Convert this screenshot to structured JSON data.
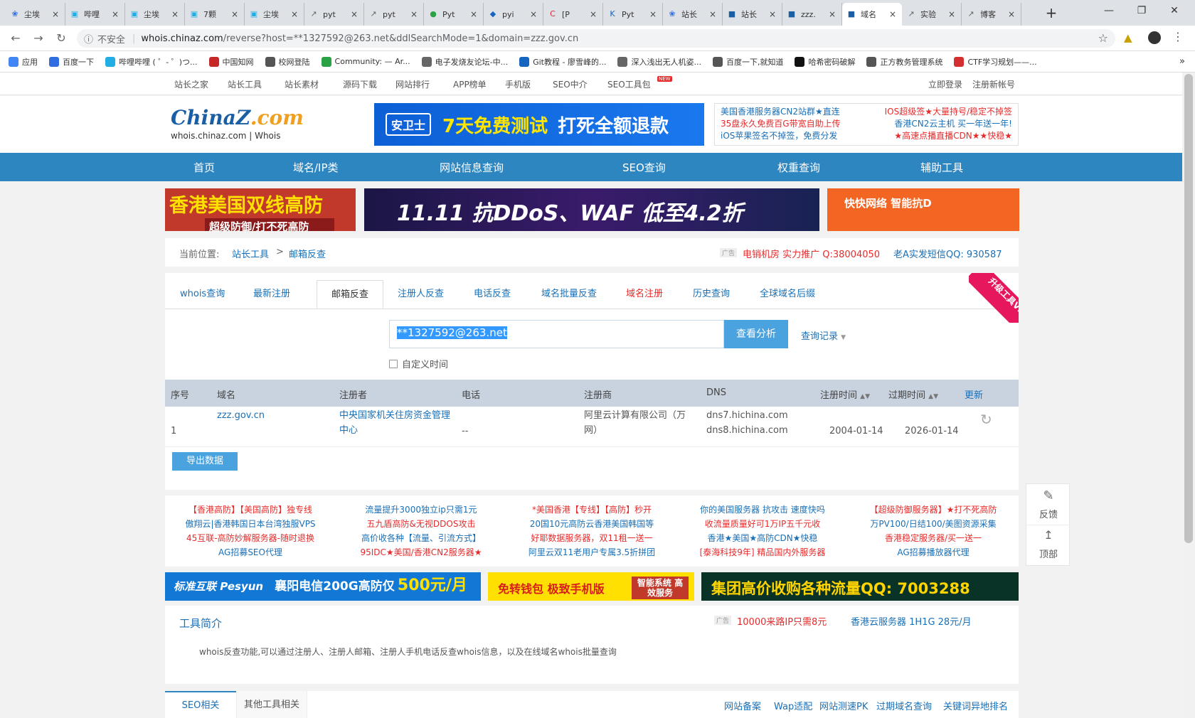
{
  "browser": {
    "tabs": [
      {
        "title": "尘埃",
        "icon": "paw-icon",
        "color": "#2f6de1"
      },
      {
        "title": "哔哩",
        "icon": "tv-icon",
        "color": "#23ade5"
      },
      {
        "title": "尘埃",
        "icon": "tv-icon",
        "color": "#23ade5"
      },
      {
        "title": "7颗",
        "icon": "tv-icon",
        "color": "#23ade5"
      },
      {
        "title": "尘埃",
        "icon": "tv-icon",
        "color": "#23ade5"
      },
      {
        "title": "pyt",
        "icon": "rocket-icon",
        "color": "#666666"
      },
      {
        "title": "pyt",
        "icon": "rocket-icon",
        "color": "#666666"
      },
      {
        "title": "Pyt",
        "icon": "chat-icon",
        "color": "#2ba245"
      },
      {
        "title": "pyi",
        "icon": "shield-icon",
        "color": "#1565c0"
      },
      {
        "title": "[P",
        "icon": "c-icon",
        "color": "#d32f2f"
      },
      {
        "title": "Pyt",
        "icon": "k-icon",
        "color": "#1565c0"
      },
      {
        "title": "站长",
        "icon": "paw-icon",
        "color": "#2f6de1"
      },
      {
        "title": "站长",
        "icon": "chinaz-icon",
        "color": "#1a5fa5"
      },
      {
        "title": "zzz.",
        "icon": "chinaz-icon",
        "color": "#1a5fa5"
      },
      {
        "title": "域名",
        "icon": "chinaz-icon",
        "color": "#1a5fa5"
      },
      {
        "title": "实验",
        "icon": "rocket-icon",
        "color": "#666666"
      },
      {
        "title": "博客",
        "icon": "rocket-icon",
        "color": "#666666"
      }
    ],
    "active_tab": 14,
    "insecure_label": "不安全",
    "url_host": "whois.chinaz.com",
    "url_path": "/reverse?host=**1327592@263.net&ddlSearchMode=1&domain=zzz.gov.cn",
    "bookmarks": [
      {
        "label": "应用",
        "color": "#4285f4"
      },
      {
        "label": "百度一下",
        "color": "#2f6de1"
      },
      {
        "label": "哔哩哔哩 ( ゜- ゜)つ...",
        "color": "#23ade5"
      },
      {
        "label": "中国知网",
        "color": "#c62828"
      },
      {
        "label": "校网登陆",
        "color": "#555555"
      },
      {
        "label": "Community: — Ar...",
        "color": "#2ba245"
      },
      {
        "label": "电子发烧友论坛-中...",
        "color": "#666666"
      },
      {
        "label": "Git教程 - 廖雪峰的...",
        "color": "#1565c0"
      },
      {
        "label": "深入浅出无人机姿...",
        "color": "#666666"
      },
      {
        "label": "百度一下,就知道",
        "color": "#555555"
      },
      {
        "label": "哈希密码破解",
        "color": "#111111"
      },
      {
        "label": "正方教务管理系统",
        "color": "#555555"
      },
      {
        "label": "CTF学习规划——...",
        "color": "#d32f2f"
      }
    ],
    "bookmarks_more": "»"
  },
  "topstrip": {
    "links": [
      "站长之家",
      "站长工具",
      "站长素材",
      "源码下载",
      "网站排行",
      "APP榜单",
      "手机版",
      "SEO中介",
      "SEO工具包"
    ],
    "new_badge": "NEW",
    "login": "立即登录",
    "register": "注册新帐号"
  },
  "header": {
    "logo_main": "ChinaZ",
    "logo_dotcom": ".com",
    "logo_sub": "whois.chinaz.com | Whois",
    "ad_brand": "安卫士",
    "ad_brand_sub": "anweishi.com",
    "ad_h1": "7天免费测试",
    "ad_h2": "打死全额退款",
    "ad_text": [
      [
        "美国香港服务器CN2站群★直连",
        "IOS超级签★大量持号/稳定不掉签"
      ],
      [
        "35盘永久免费百G带宽自助上传",
        "香港CN2云主机 买一年送一年!"
      ],
      [
        "iOS苹果签名不掉签，免费分发",
        "★高速点播直播CDN★★快稳★"
      ]
    ],
    "ad_label": "广告"
  },
  "nav": [
    "首页",
    "域名/IP类",
    "网站信息查询",
    "SEO查询",
    "权重查询",
    "辅助工具"
  ],
  "banners": {
    "b1_line1": "香港美国双线高防",
    "b1_line2": "超级防御/打不死高防",
    "b2_text": "11.11 抗DDoS、WAF 低至4.2折",
    "b3_text": "快快网络  智能抗D"
  },
  "breadcrumb": {
    "label": "当前位置:",
    "item1": "站长工具",
    "sep": ">",
    "item2": "邮箱反查",
    "ad_tag": "广告",
    "ad1": "电销机房 实力推广 Q:38004050",
    "ad2": "老A实发短信QQ: 930587"
  },
  "tool": {
    "tabs": [
      "whois查询",
      "最新注册",
      "邮箱反查",
      "注册人反查",
      "电话反查",
      "域名批量反查",
      "域名注册",
      "历史查询",
      "全球域名后缀"
    ],
    "selected_tab": 2,
    "vip_badge": "升级工具VIP",
    "search_value": "**1327592@263.net",
    "search_button": "查看分析",
    "history_link": "查询记录",
    "custom_time": "自定义时间",
    "table": {
      "headers": [
        "序号",
        "域名",
        "注册者",
        "电话",
        "注册商",
        "DNS",
        "注册时间",
        "过期时间",
        "更新"
      ],
      "rows": [
        {
          "no": "1",
          "domain": "zzz.gov.cn",
          "registrant": "中央国家机关住房资金管理中心",
          "phone": "--",
          "registrar": "阿里云计算有限公司（万网）",
          "dns1": "dns7.hichina.com",
          "dns2": "dns8.hichina.com",
          "reg_date": "2004-01-14",
          "exp_date": "2026-01-14"
        }
      ]
    },
    "export_button": "导出数据"
  },
  "adlinks": [
    [
      "【香港高防】【美国高防】独专线",
      "傲翔云|香港韩国日本台湾独服VPS",
      "45互联-高防妙解服务器-随时退换",
      "AG招募SEO代理"
    ],
    [
      "流量提升3000独立ip只需1元",
      "五九盾高防&无视DDOS攻击",
      "高价收各种【流量、引流方式】",
      "95IDC★美国/香港CN2服务器★"
    ],
    [
      "*美国香港【专线】【高防】秒开",
      "20国10元高防云香港美国韩国等",
      "好耶数据服务器，双11租一送一",
      "阿里云双11老用户专属3.5折拼团"
    ],
    [
      "你的美国服务器 抗攻击 速度快吗",
      "收流量质量好可1万IP五千元收",
      "香港★美国★高防CDN★快稳",
      "[泰海科技9年] 精品国内外服务器"
    ],
    [
      "【超级防御服务器】★打不死高防",
      "万PV100/日结100/美图资源采集",
      "香港稳定服务器/买一送一",
      "AG招募播放器代理"
    ]
  ],
  "banner_row": {
    "br1_brand": "标准互联 Pesyun",
    "br1_text": "襄阳电信200G高防仅",
    "br1_price": "500元/月",
    "br2_text": "免转钱包 极致手机版",
    "br2_side": "智能系统 高效服务",
    "br3_text": "集团高价收购各种流量QQ: 7003288"
  },
  "intro": {
    "title": "工具简介",
    "ad_tag": "广告",
    "ad1": "10000来路IP只需8元",
    "ad2": "香港云服务器 1H1G 28元/月",
    "text": "whois反查功能,可以通过注册人、注册人邮箱、注册人手机电话反查whois信息，以及在线域名whois批量查询"
  },
  "seo": {
    "tab1": "SEO相关",
    "tab2": "其他工具相关",
    "links": [
      "网站备案",
      "Wap适配",
      "网站测速PK",
      "过期域名查询",
      "关键词异地排名"
    ]
  },
  "sidefloat": {
    "feedback": "反馈",
    "top": "顶部"
  }
}
